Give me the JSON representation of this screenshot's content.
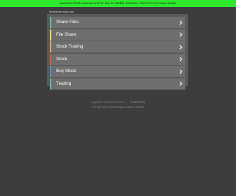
{
  "notice": {
    "text": "Sponsored hub reserved and for sale for Mobile Solutions. Click here for more details."
  },
  "domain_label": "hbstockes-asia.com",
  "links": [
    {
      "label": "Share Files",
      "accent": "#4fc3b5"
    },
    {
      "label": "File Share",
      "accent": "#f0e04a"
    },
    {
      "label": "Stock Trading",
      "accent": "#ffa64d"
    },
    {
      "label": "Stock",
      "accent": "#e25a2e"
    },
    {
      "label": "Buy Stock",
      "accent": "#4b8fd6"
    },
    {
      "label": "Trading",
      "accent": "#4fc3b5"
    }
  ],
  "footer": {
    "copyright": "Copyright © All rights reserved.",
    "privacy": "Privacy Policy",
    "disclaimer_prefix": "The Sale link is a domain",
    "disclaimer_link": "Buy",
    "disclaimer_suffix": "contact us Lifestyle"
  },
  "colors": {
    "background": "#3d3d3d",
    "notice_bar": "#2ee82e",
    "panel": "#5a5a5a",
    "link_bg": "#6e6e6e"
  }
}
